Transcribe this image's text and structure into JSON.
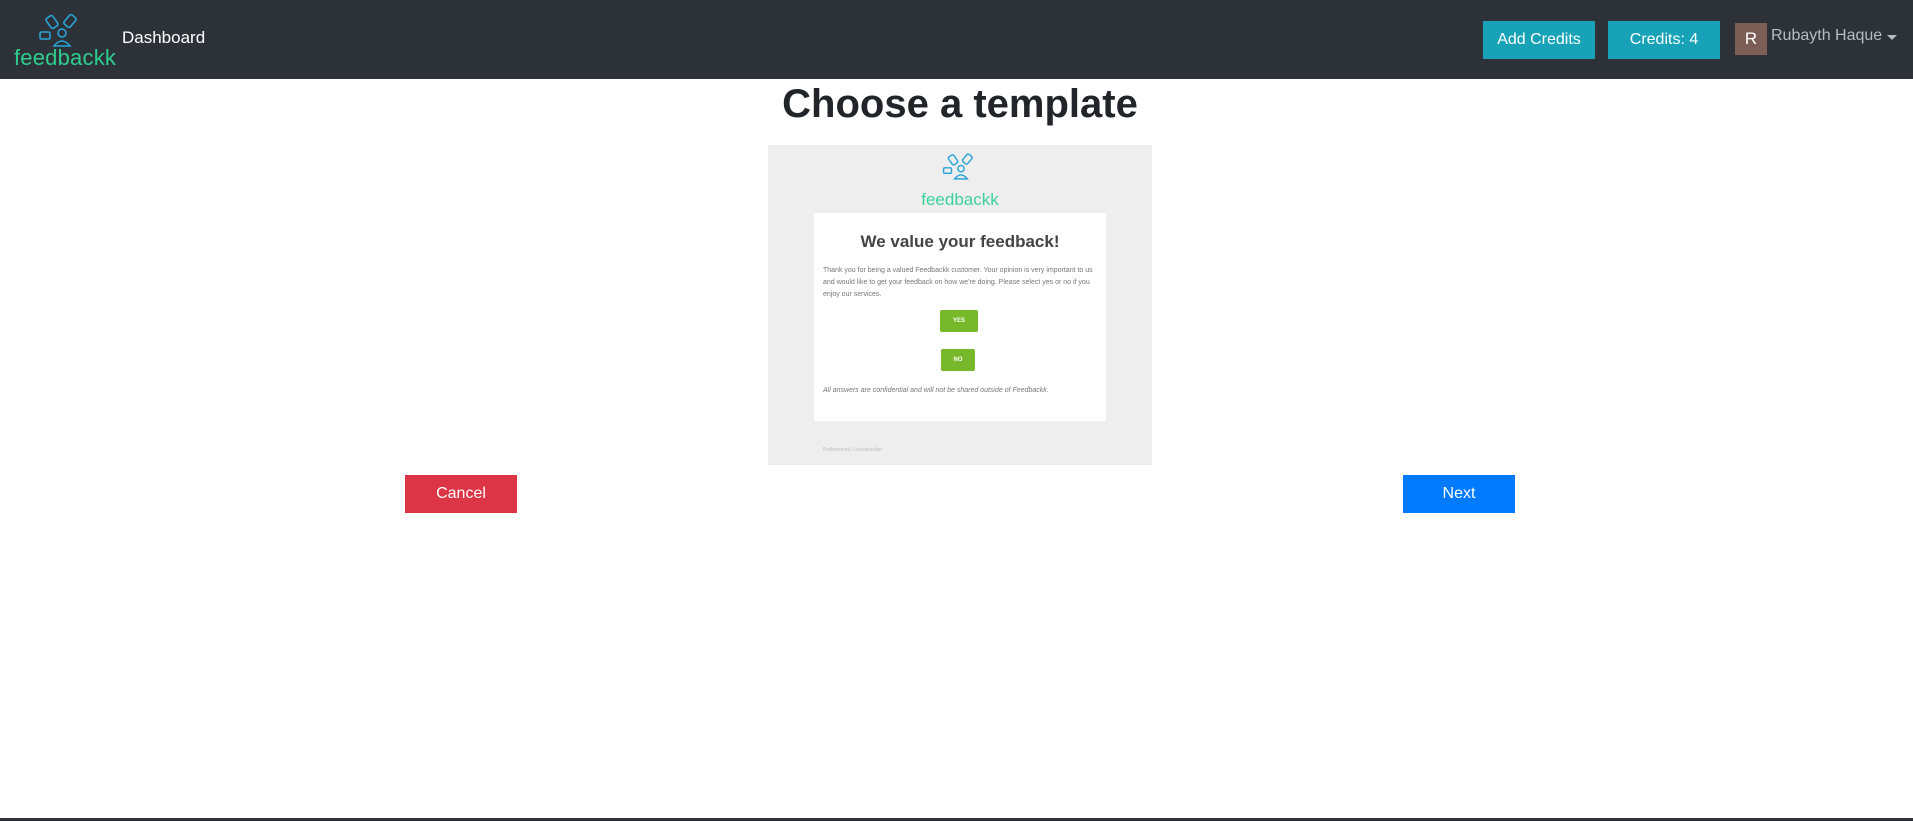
{
  "navbar": {
    "brand": "feedbackk",
    "dashboard_link": "Dashboard",
    "add_credits_label": "Add Credits",
    "credits_label": "Credits: 4",
    "avatar_initial": "R",
    "user_name": "Rubayth Haque"
  },
  "main": {
    "title": "Choose a template",
    "cancel_label": "Cancel",
    "next_label": "Next"
  },
  "template_preview": {
    "brand": "feedbackk",
    "heading": "We value your feedback!",
    "body_text": "Thank you for being a valued Feedbackk customer. Your opinion is very important to us and would like to get your feedback on how we're doing. Please select yes or no if you enjoy our services.",
    "yes_label": "YES",
    "no_label": "NO",
    "note": "All answers are confidential and will not be shared outside of Feedbackk.",
    "footer": "Preferences  |  Unsubscribe"
  },
  "colors": {
    "navbar_bg": "#2d3238",
    "info": "#17a2b8",
    "danger": "#dc3545",
    "primary": "#007bff",
    "brand_green": "#2ccf8e",
    "brand_blue": "#28a4d6",
    "preview_button": "#77b82a"
  },
  "icons": {
    "logo": "feedbackk-logo-icon",
    "caret": "caret-down-icon"
  }
}
